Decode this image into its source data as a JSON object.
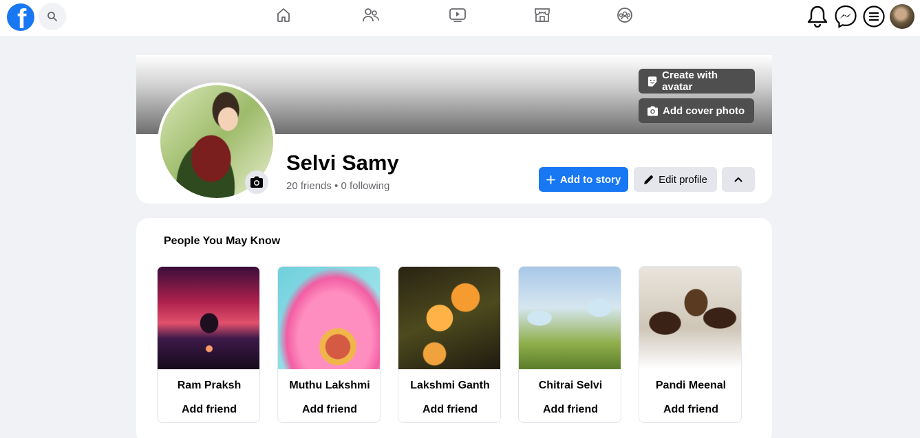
{
  "colors": {
    "brand": "#1877f2",
    "page_bg": "#f0f2f5",
    "button_dark": "#4f4f4f",
    "secondary_text": "#65676b"
  },
  "header": {
    "logo_letter": "f",
    "icons": [
      "facebook-logo",
      "search-icon",
      "home-icon",
      "friends-icon",
      "watch-icon",
      "marketplace-icon",
      "groups-icon",
      "notifications-bell-icon",
      "messenger-icon",
      "menu-icon",
      "account-avatar"
    ]
  },
  "cover": {
    "create_avatar_label": "Create with avatar",
    "add_cover_label": "Add cover photo"
  },
  "profile": {
    "name": "Selvi Samy",
    "stats": "20 friends • 0 following",
    "add_story_label": "Add to story",
    "edit_profile_label": "Edit profile"
  },
  "pymk": {
    "title": "People You May Know",
    "people": [
      {
        "name": "Ram Praksh",
        "action": "Add friend"
      },
      {
        "name": "Muthu Lakshmi",
        "action": "Add friend"
      },
      {
        "name": "Lakshmi Ganth",
        "action": "Add friend"
      },
      {
        "name": "Chitrai Selvi",
        "action": "Add friend"
      },
      {
        "name": "Pandi Meenal",
        "action": "Add friend"
      }
    ]
  }
}
